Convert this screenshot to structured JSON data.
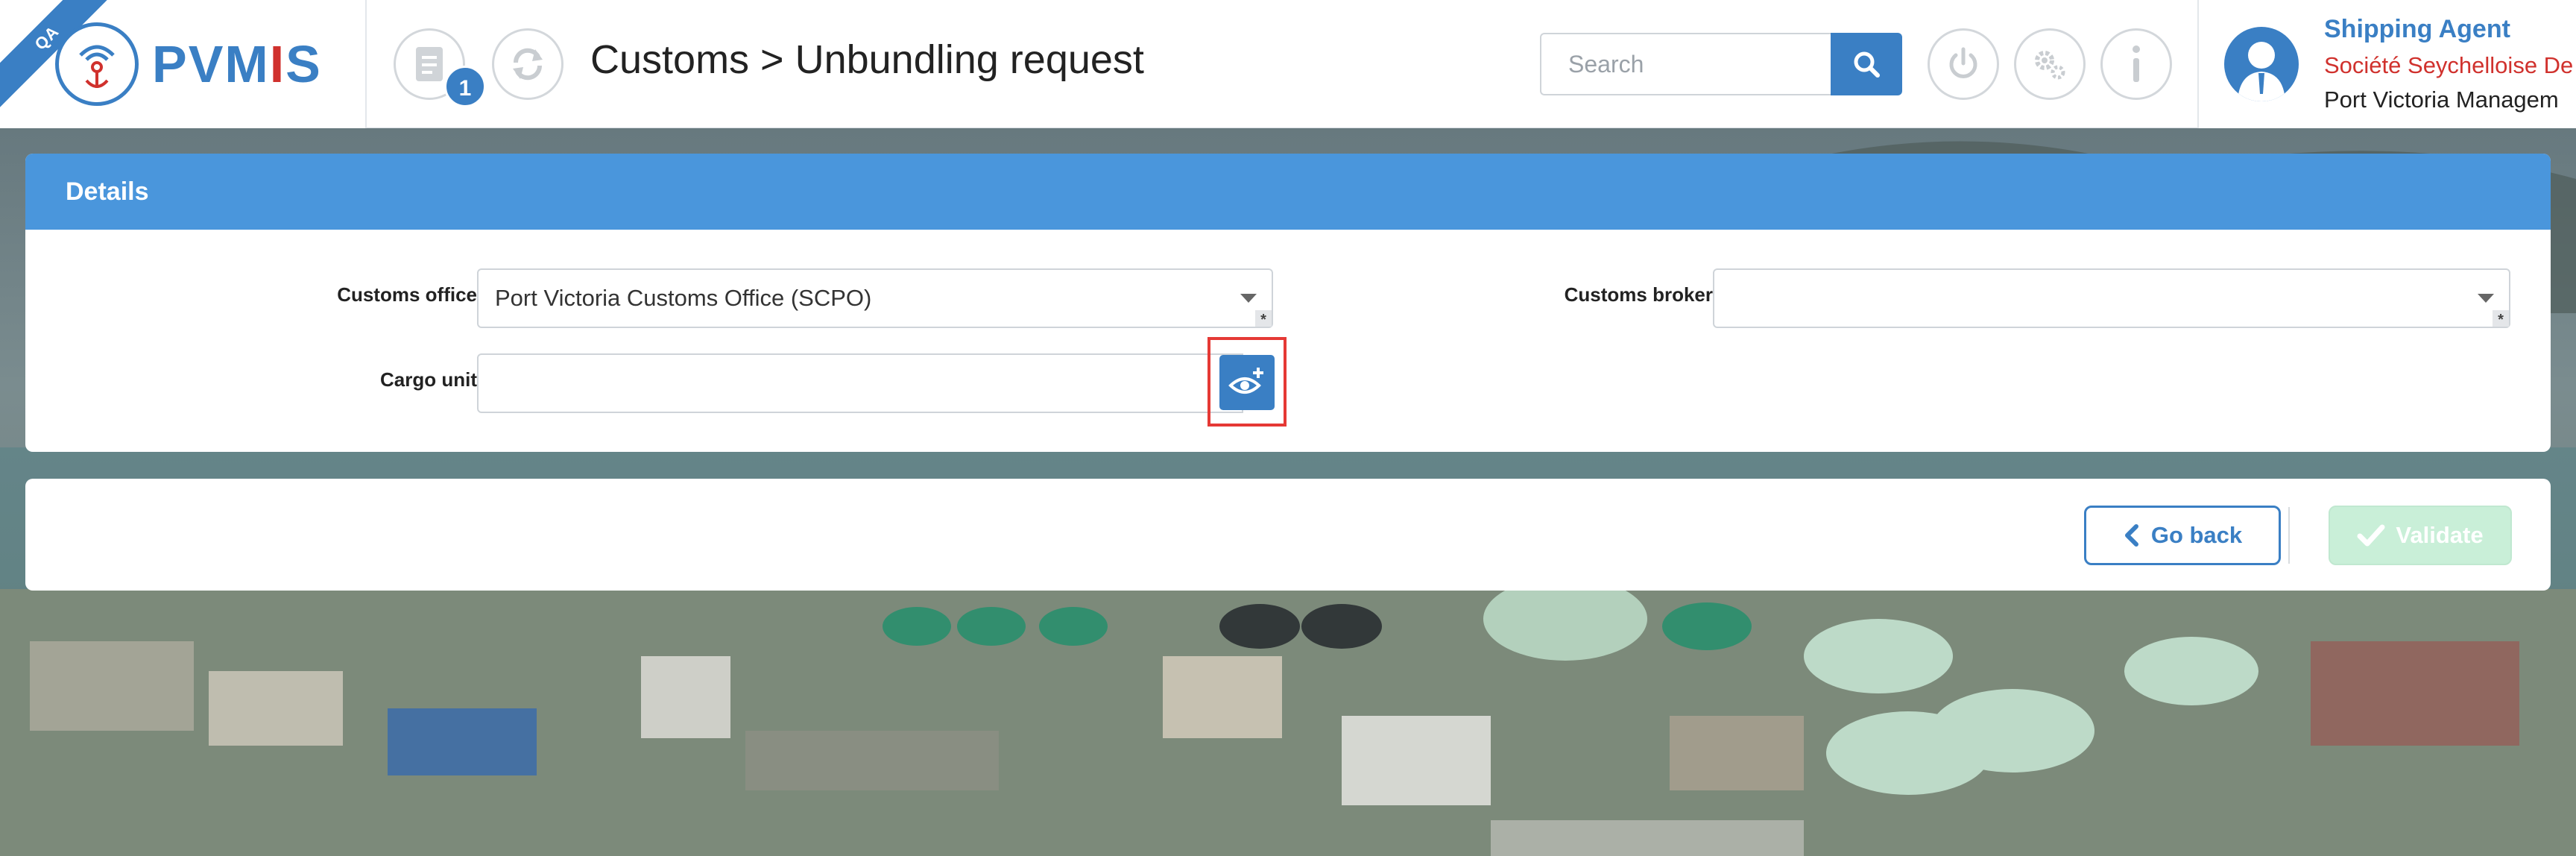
{
  "app": {
    "ribbon": "QA",
    "logo": {
      "part1": "PVM",
      "part2": "I",
      "part3": "S"
    },
    "title": "Customs > Unbundling request"
  },
  "header": {
    "notification_count": "1",
    "search": {
      "placeholder": "Search",
      "value": ""
    },
    "icons": [
      "document-icon",
      "refresh-icon",
      "power-icon",
      "settings-icon",
      "info-icon"
    ]
  },
  "user": {
    "role": "Shipping Agent",
    "company": "Société Seychelloise De",
    "organization": "Port Victoria Managem"
  },
  "details": {
    "heading": "Details",
    "customs_office": {
      "label": "Customs office",
      "value": "Port Victoria Customs Office (SCPO)",
      "required_mark": "*"
    },
    "customs_broker": {
      "label": "Customs broker",
      "value": "",
      "required_mark": "*"
    },
    "cargo_unit": {
      "label": "Cargo unit",
      "value": ""
    }
  },
  "actions": {
    "go_back": "Go back",
    "validate": "Validate"
  },
  "colors": {
    "brand_blue": "#3a7fc4",
    "panel_header": "#4a96dc",
    "brand_red": "#d0312d",
    "validate_disabled": "#c9efd8",
    "highlight": "#e53935"
  }
}
